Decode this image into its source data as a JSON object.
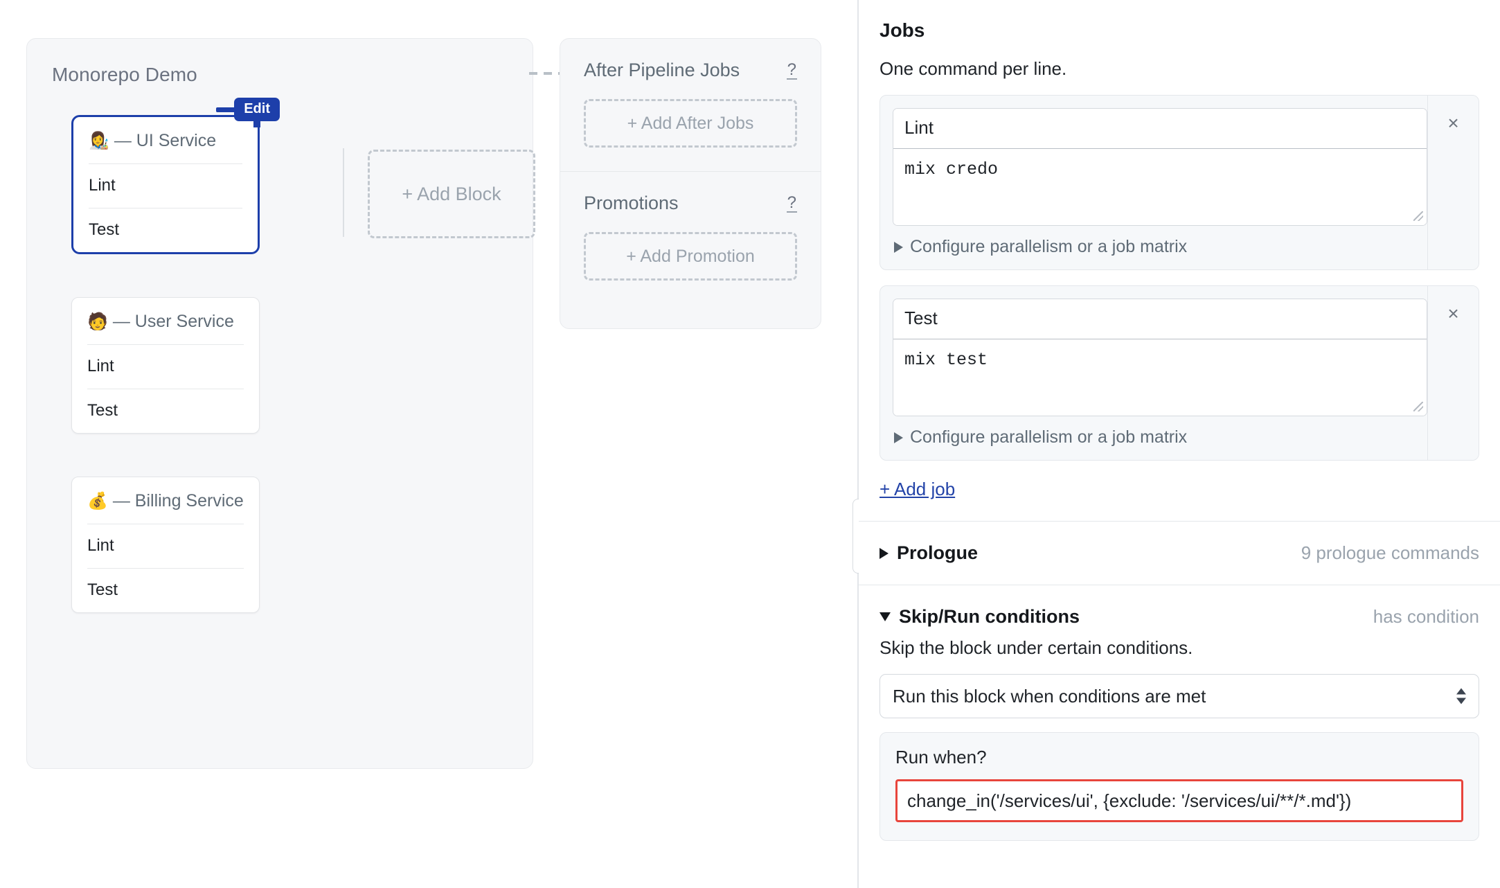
{
  "pipeline": {
    "title": "Monorepo Demo",
    "blocks": [
      {
        "emoji": "👩‍🎨",
        "name": "— UI Service",
        "selected": true,
        "badge": "Edit",
        "jobs": [
          "Lint",
          "Test"
        ]
      },
      {
        "emoji": "🧑",
        "name": "— User Service",
        "selected": false,
        "badge": "",
        "jobs": [
          "Lint",
          "Test"
        ]
      },
      {
        "emoji": "💰",
        "name": "— Billing Service",
        "selected": false,
        "badge": "",
        "jobs": [
          "Lint",
          "Test"
        ]
      }
    ],
    "add_block_label": "+ Add Block"
  },
  "side_panel": {
    "after_jobs": {
      "heading": "After Pipeline Jobs",
      "help": "?",
      "add_label": "+ Add After Jobs"
    },
    "promotions": {
      "heading": "Promotions",
      "help": "?",
      "add_label": "+ Add Promotion"
    }
  },
  "settings": {
    "jobs_heading": "Jobs",
    "jobs_hint": "One command per line.",
    "jobs": [
      {
        "name": "Lint",
        "commands": "mix credo",
        "matrix_label": "Configure parallelism or a job matrix",
        "delete_label": "×"
      },
      {
        "name": "Test",
        "commands": "mix test",
        "matrix_label": "Configure parallelism or a job matrix",
        "delete_label": "×"
      }
    ],
    "add_job_label": "+ Add job",
    "prologue": {
      "title": "Prologue",
      "meta": "9 prologue commands"
    },
    "skip_run": {
      "title": "Skip/Run conditions",
      "meta": "has condition",
      "description": "Skip the block under certain conditions.",
      "mode_value": "Run this block when conditions are met",
      "run_when_label": "Run when?",
      "condition_value": "change_in('/services/ui', {exclude: '/services/ui/**/*.md'})"
    }
  },
  "colors": {
    "accent_blue": "#1d3faa",
    "link_blue": "#2343a8",
    "error_red": "#e8453c",
    "panel_grey": "#f6f7f9"
  }
}
